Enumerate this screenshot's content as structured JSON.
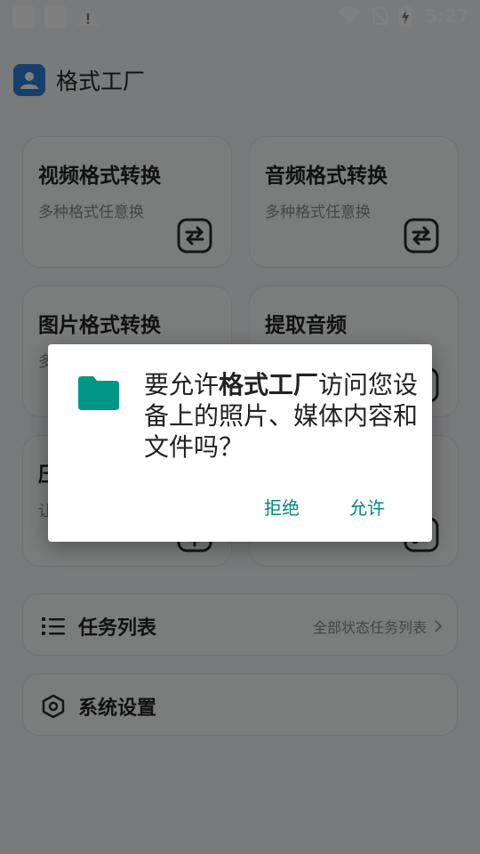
{
  "status_bar": {
    "time": "5:27"
  },
  "app": {
    "title": "格式工厂"
  },
  "cards": [
    {
      "title": "视频格式转换",
      "subtitle": "多种格式任意换",
      "icon": "convert-icon"
    },
    {
      "title": "音频格式转换",
      "subtitle": "多种格式任意换",
      "icon": "convert-icon"
    },
    {
      "title": "图片格式转换",
      "subtitle": "多",
      "icon": "convert-icon"
    },
    {
      "title": "提取音频",
      "subtitle": "",
      "icon": "music-icon"
    },
    {
      "title": "压",
      "subtitle": "让",
      "icon": "compress-icon"
    },
    {
      "title": "",
      "subtitle": "",
      "icon": "music-icon"
    }
  ],
  "task_list": {
    "title": "任务列表",
    "right_label": "全部状态任务列表",
    "icon": "list-icon"
  },
  "settings": {
    "title": "系统设置",
    "icon": "settings-icon"
  },
  "dialog": {
    "message_prefix": "要允许",
    "app_name": "格式工厂",
    "message_suffix": "访问您设备上的照片、媒体内容和文件吗？",
    "deny_label": "拒绝",
    "allow_label": "允许",
    "icon": "folder-icon",
    "icon_color": "#009688",
    "button_color": "#00897b"
  }
}
